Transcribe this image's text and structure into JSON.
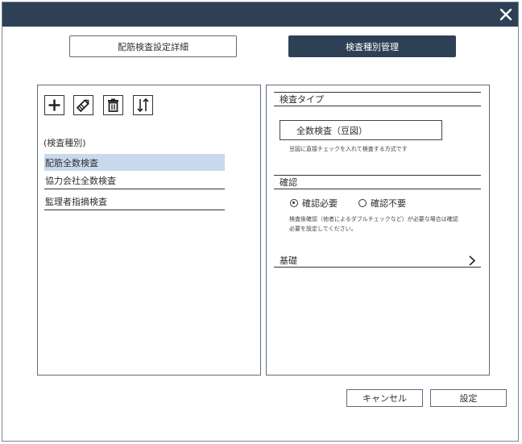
{
  "tabs": {
    "detail_label": "配筋検査設定詳細",
    "manage_label": "検査種別管理"
  },
  "toolbar": {
    "add_icon": "plus-icon",
    "edit_icon": "pencil-icon",
    "delete_icon": "trash-icon",
    "sort_icon": "sort-icon"
  },
  "inspection_list": {
    "header": "(検査種別)",
    "items": [
      {
        "label": "配筋全数検査",
        "selected": true
      },
      {
        "label": "協力会社全数検査",
        "selected": false
      },
      {
        "label": "監理者指摘検査",
        "selected": false
      }
    ]
  },
  "details": {
    "type_section": "検査タイプ",
    "type_value": "全数検査（豆図）",
    "type_note": "豆図に直接チェックを入れて検査する方式です",
    "confirm_section": "確認",
    "confirm_options": [
      "確認必要",
      "確認不要"
    ],
    "confirm_selected": "確認必要",
    "confirm_note_1": "検査後確認（他者によるダブルチェックなど）が必要な場合は確認",
    "confirm_note_2": "必要を設定してください。",
    "basic_section": "基礎"
  },
  "footer": {
    "cancel_label": "キャンセル",
    "ok_label": "設定"
  },
  "colors": {
    "titlebar": "#2e4055",
    "selected_row": "#c9d9ec"
  }
}
